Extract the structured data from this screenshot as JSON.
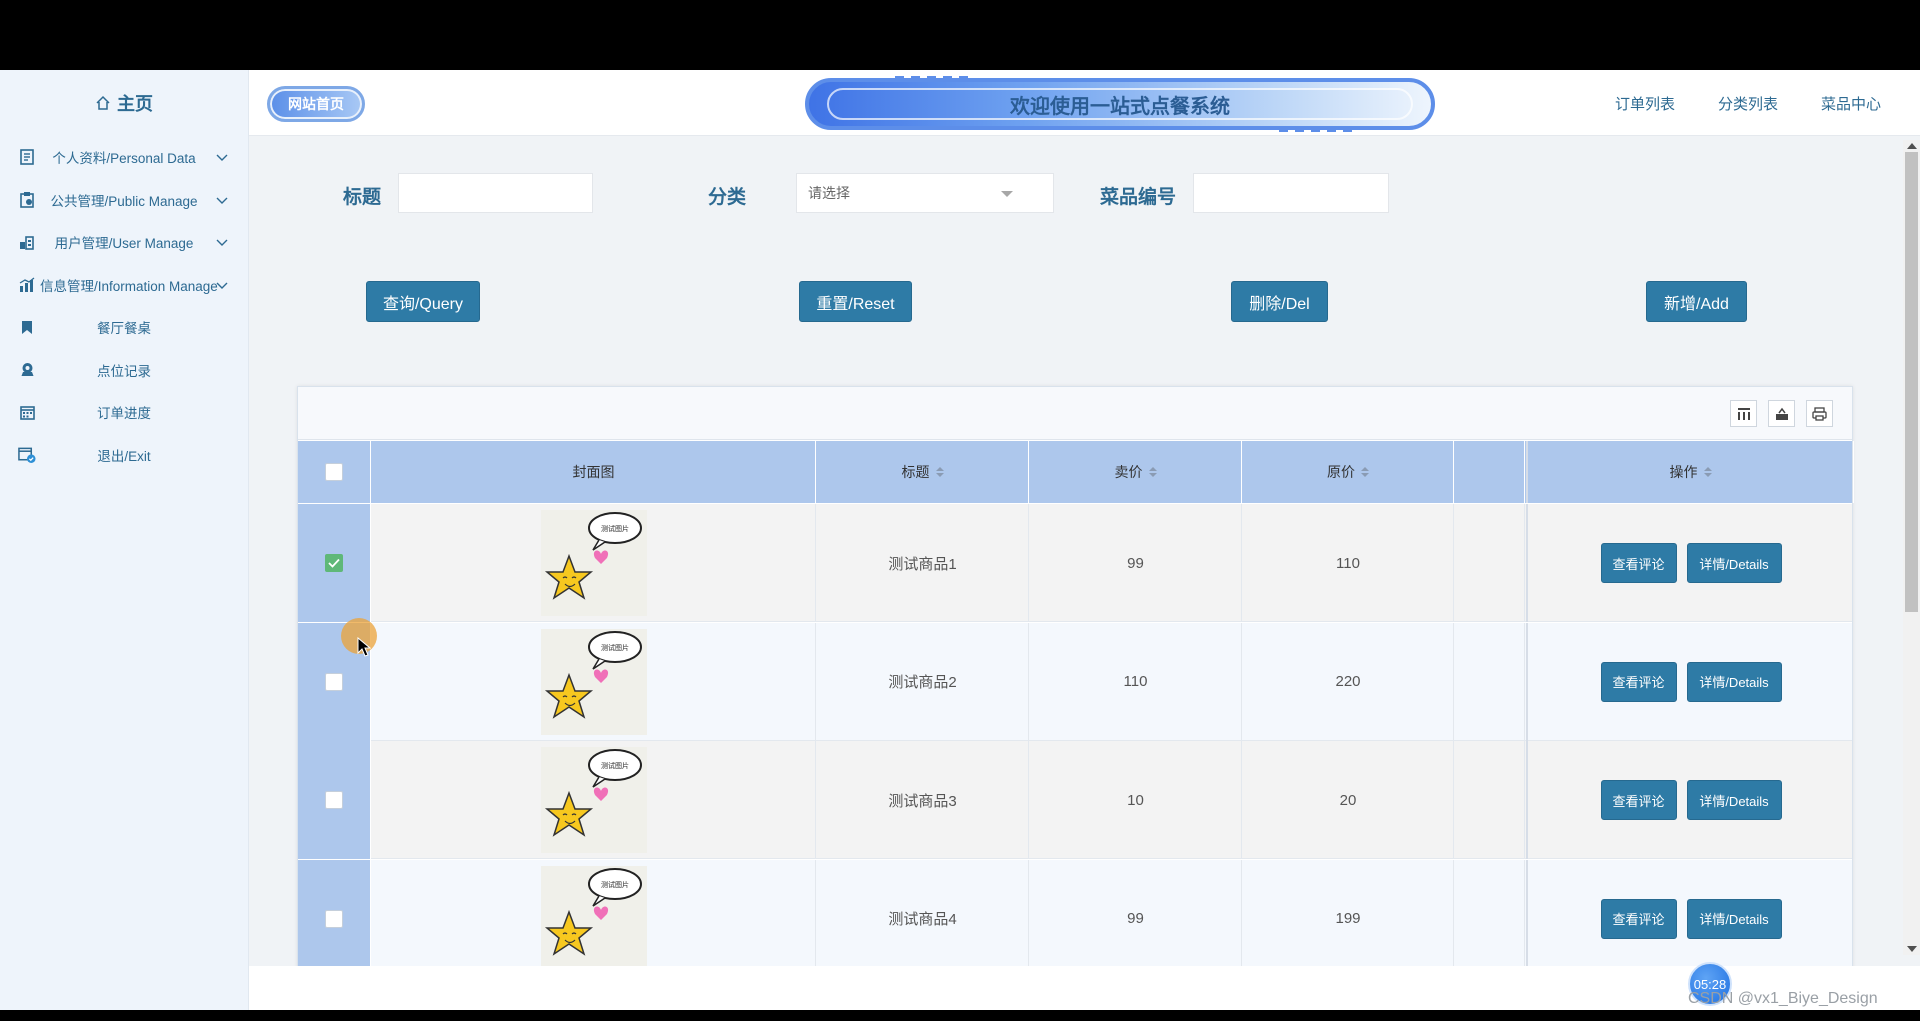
{
  "sidebar": {
    "home": "主页",
    "items": [
      {
        "label": "个人资料/Personal Data",
        "icon": "document-icon",
        "has_chevron": true
      },
      {
        "label": "公共管理/Public Manage",
        "icon": "clipboard-icon",
        "has_chevron": true
      },
      {
        "label": "用户管理/User Manage",
        "icon": "building-icon",
        "has_chevron": true
      },
      {
        "label": "信息管理/Information Manage",
        "icon": "bar-chart-icon",
        "has_chevron": true
      },
      {
        "label": "餐厅餐桌",
        "icon": "bookmark-icon",
        "has_chevron": false
      },
      {
        "label": "点位记录",
        "icon": "award-icon",
        "has_chevron": false
      },
      {
        "label": "订单进度",
        "icon": "calendar-icon",
        "has_chevron": false
      },
      {
        "label": "退出/Exit",
        "icon": "calendar-check-icon",
        "has_chevron": false
      }
    ]
  },
  "header": {
    "home_badge": "网站首页",
    "banner": "欢迎使用一站式点餐系统",
    "nav": [
      "订单列表",
      "分类列表",
      "菜品中心"
    ]
  },
  "search": {
    "title_label": "标题",
    "title_value": "",
    "category_label": "分类",
    "category_placeholder": "请选择",
    "dish_no_label": "菜品编号",
    "dish_no_value": ""
  },
  "actions": {
    "query": "查询/Query",
    "reset": "重置/Reset",
    "delete": "删除/Del",
    "add": "新增/Add"
  },
  "table": {
    "headers": {
      "cover": "封面图",
      "title": "标题",
      "price": "卖价",
      "original": "原价",
      "ops": "操作"
    },
    "rows": [
      {
        "title": "测试商品1",
        "price": "99",
        "original": "110",
        "checked": true
      },
      {
        "title": "测试商品2",
        "price": "110",
        "original": "220",
        "checked": false
      },
      {
        "title": "测试商品3",
        "price": "10",
        "original": "20",
        "checked": false
      },
      {
        "title": "测试商品4",
        "price": "99",
        "original": "199",
        "checked": false
      }
    ],
    "thumb_bubble_text": "测试图片",
    "op_review": "查看评论",
    "op_details": "详情/Details"
  },
  "overlay": {
    "timer": "05:28",
    "watermark": "CSDN @vx1_Biye_Design"
  },
  "colors": {
    "primary_button": "#2e7ba6",
    "header_row": "#adc7ec",
    "sidebar_bg": "#eef4fb",
    "sidebar_text": "#2d6a92"
  }
}
